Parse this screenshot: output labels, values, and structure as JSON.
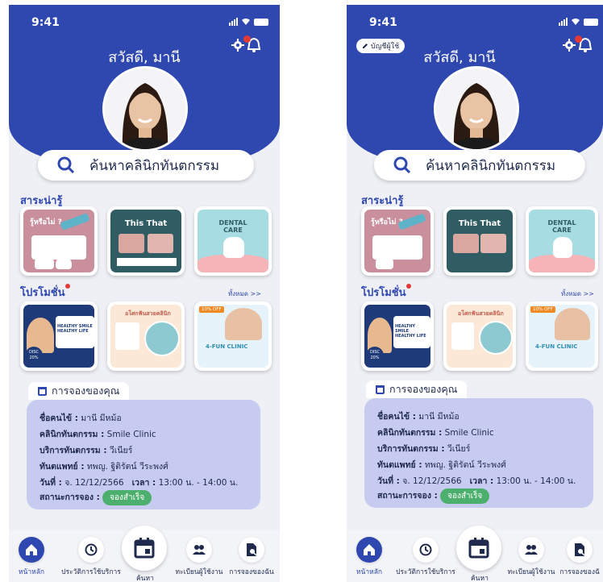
{
  "colors": {
    "primary": "#2f48b0",
    "booking_bg": "#c6cbef",
    "success": "#4caf6d",
    "notif": "#e53935"
  },
  "status_bar": {
    "time": "9:41"
  },
  "header": {
    "greeting": "สวัสดี, มานี",
    "edit_account": "บัญชีผู้ใช้"
  },
  "search": {
    "placeholder": "ค้นหาคลินิกทันตกรรม"
  },
  "articles": {
    "title": "สาระน่ารู้",
    "cards": [
      {
        "caption": "รู้หรือไม่ ?"
      },
      {
        "caption_a": "This",
        "caption_b": "That"
      },
      {
        "caption_a": "DENTAL",
        "caption_b": "CARE"
      }
    ]
  },
  "promotions": {
    "title": "โปรโมชั่น",
    "see_all": "ทั้งหมด >>",
    "cards": [
      {
        "headline": "HEALTHY SMILE HEALTHY LIFE",
        "badge_a": "DISC",
        "badge_b": "20%"
      },
      {
        "headline": "อโศกฟันสวยคลินิก"
      },
      {
        "badge": "10% OFF",
        "headline": "4-FUN CLINIC"
      }
    ]
  },
  "booking": {
    "title": "การจองของคุณ",
    "patient_label": "ชื่อคนไข้ :",
    "patient": "มานี มีหม้อ",
    "clinic_label": "คลินิกทันตกรรม :",
    "clinic": "Smile Clinic",
    "service_label": "บริการทันตกรรม :",
    "service": "วีเนียร์",
    "dentist_label": "ทันตแพทย์ :",
    "dentist": "ทพญ. ฐิติรัตน์ วีระพงศ์",
    "date_label": "วันที่ :",
    "date": "จ. 12/12/2566",
    "time_label": "เวลา :",
    "time": "13:00 น. - 14:00 น.",
    "status_label": "สถานะการจอง :",
    "status": "จองสำเร็จ"
  },
  "nav": {
    "home": "หน้าหลัก",
    "history": "ประวัติการใช้บริการ",
    "search": "ค้นหา",
    "register": "ทะเบียนผู้ใช้งาน",
    "bookings_left": "การจองของฉัน",
    "bookings_right": "การจองของฉั"
  }
}
